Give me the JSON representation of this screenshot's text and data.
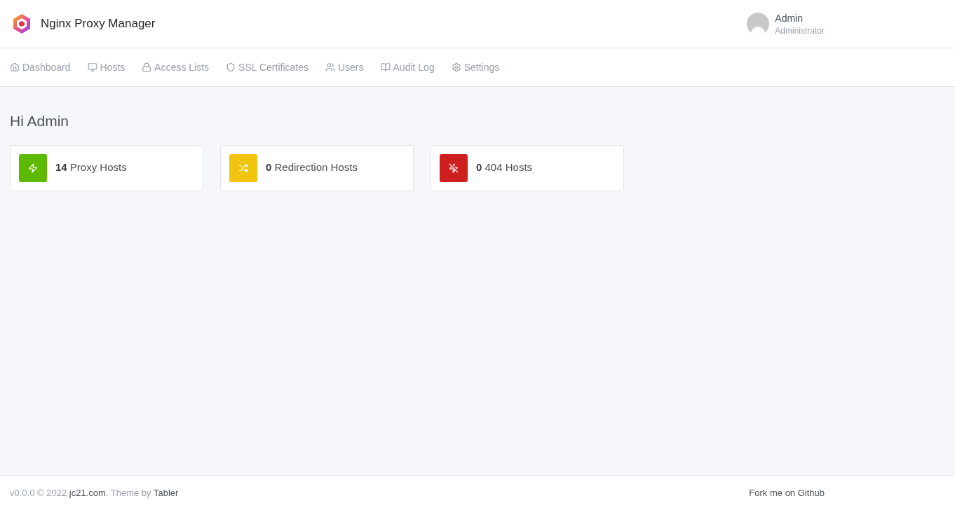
{
  "header": {
    "title": "Nginx Proxy Manager",
    "user": {
      "name": "Admin",
      "role": "Administrator"
    }
  },
  "nav": [
    {
      "kind": "home",
      "label": "Dashboard"
    },
    {
      "kind": "monitor",
      "label": "Hosts"
    },
    {
      "kind": "lock",
      "label": "Access Lists"
    },
    {
      "kind": "shield",
      "label": "SSL Certificates"
    },
    {
      "kind": "users",
      "label": "Users"
    },
    {
      "kind": "book",
      "label": "Audit Log"
    },
    {
      "kind": "gear",
      "label": "Settings"
    }
  ],
  "greeting": "Hi Admin",
  "stats": [
    {
      "kind": "proxy",
      "color": "#5eba00",
      "count": "14",
      "label": "Proxy Hosts"
    },
    {
      "kind": "redirection",
      "color": "#f1c40f",
      "count": "0",
      "label": "Redirection Hosts"
    },
    {
      "kind": "dead",
      "color": "#cd201f",
      "count": "0",
      "label": "404 Hosts"
    }
  ],
  "footer": {
    "version": "v0.0.0 © 2022",
    "site_link": "jc21.com",
    "theme_text": ". Theme by",
    "theme_link": "Tabler",
    "github_link": "Fork me on Github"
  }
}
